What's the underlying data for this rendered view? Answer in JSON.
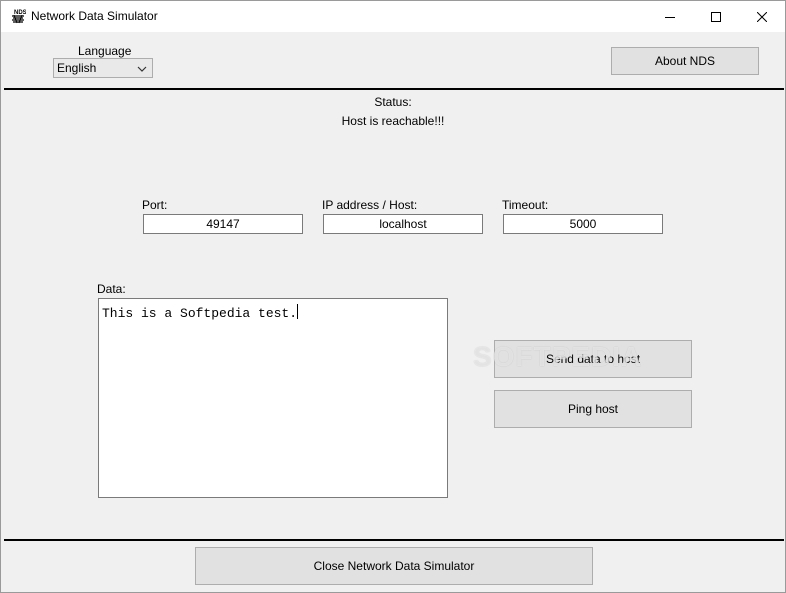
{
  "window": {
    "title": "Network Data Simulator",
    "controls": {
      "minimize": "minimize-icon",
      "maximize": "maximize-icon",
      "close": "close-icon"
    }
  },
  "language": {
    "label": "Language",
    "selected": "English"
  },
  "about_button": "About NDS",
  "status": {
    "label": "Status:",
    "value": "Host is reachable!!!"
  },
  "fields": {
    "port": {
      "label": "Port:",
      "value": "49147"
    },
    "host": {
      "label": "IP address / Host:",
      "value": "localhost"
    },
    "timeout": {
      "label": "Timeout:",
      "value": "5000"
    }
  },
  "data": {
    "label": "Data:",
    "value": "This is a Softpedia test."
  },
  "buttons": {
    "send": "Send data to host",
    "ping": "Ping host",
    "close": "Close Network Data Simulator"
  },
  "watermark": "SOFTPEDIA",
  "colors": {
    "window_bg": "#f0f0f0",
    "titlebar_bg": "#ffffff",
    "button_bg": "#e1e1e1",
    "button_border": "#adadad",
    "separator": "#000000"
  }
}
